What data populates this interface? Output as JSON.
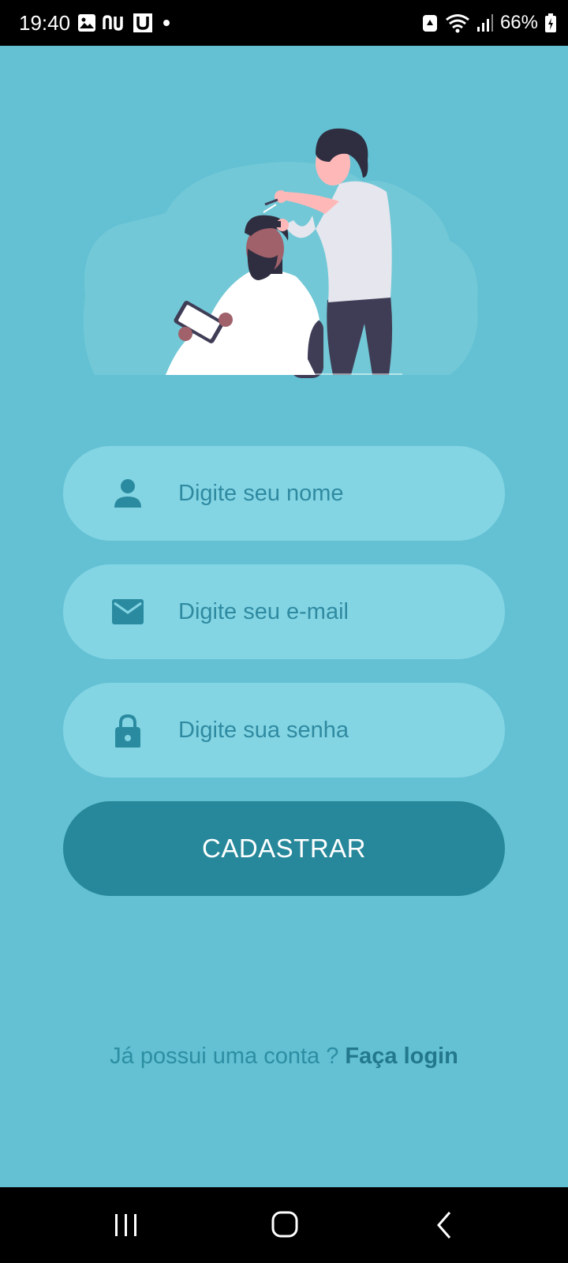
{
  "status_bar": {
    "time": "19:40",
    "app_icons": [
      "image-icon",
      "nu-icon",
      "u-icon",
      "dot-icon"
    ],
    "system_icons": [
      "alarm-icon",
      "wifi-icon",
      "signal-icon",
      "battery-icon"
    ],
    "battery": "66%"
  },
  "illustration": {
    "description_icon": "barber-illustration"
  },
  "form": {
    "name": {
      "placeholder": "Digite seu nome",
      "icon": "person-icon"
    },
    "email": {
      "placeholder": "Digite seu e-mail",
      "icon": "email-icon"
    },
    "password": {
      "placeholder": "Digite sua senha",
      "icon": "lock-icon"
    },
    "submit_label": "CADASTRAR"
  },
  "footer": {
    "prompt": "Já possui uma conta ?",
    "link": "Faça login"
  },
  "nav": {
    "icons": [
      "recent-apps-icon",
      "home-icon",
      "back-icon"
    ]
  },
  "colors": {
    "background": "#63c1d3",
    "field_bg": "#84d5e4",
    "button_bg": "#26889a",
    "icon_color": "#2a8ba0"
  }
}
